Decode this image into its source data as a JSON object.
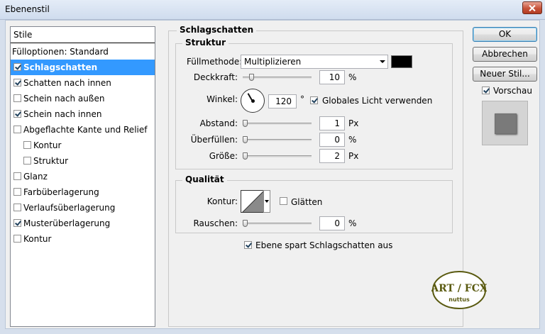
{
  "window": {
    "title": "Ebenenstil"
  },
  "styles": {
    "header": "Stile",
    "items": [
      {
        "label": "Fülloptionen: Standard",
        "has_checkbox": false,
        "checked": false,
        "selected": false,
        "indent": 0
      },
      {
        "label": "Schlagschatten",
        "has_checkbox": true,
        "checked": true,
        "selected": true,
        "indent": 0
      },
      {
        "label": "Schatten nach innen",
        "has_checkbox": true,
        "checked": true,
        "selected": false,
        "indent": 0
      },
      {
        "label": "Schein nach außen",
        "has_checkbox": true,
        "checked": false,
        "selected": false,
        "indent": 0
      },
      {
        "label": "Schein nach innen",
        "has_checkbox": true,
        "checked": true,
        "selected": false,
        "indent": 0
      },
      {
        "label": "Abgeflachte Kante und Relief",
        "has_checkbox": true,
        "checked": false,
        "selected": false,
        "indent": 0
      },
      {
        "label": "Kontur",
        "has_checkbox": true,
        "checked": false,
        "selected": false,
        "indent": 1
      },
      {
        "label": "Struktur",
        "has_checkbox": true,
        "checked": false,
        "selected": false,
        "indent": 1
      },
      {
        "label": "Glanz",
        "has_checkbox": true,
        "checked": false,
        "selected": false,
        "indent": 0
      },
      {
        "label": "Farbüberlagerung",
        "has_checkbox": true,
        "checked": false,
        "selected": false,
        "indent": 0
      },
      {
        "label": "Verlaufsüberlagerung",
        "has_checkbox": true,
        "checked": false,
        "selected": false,
        "indent": 0
      },
      {
        "label": "Musterüberlagerung",
        "has_checkbox": true,
        "checked": true,
        "selected": false,
        "indent": 0
      },
      {
        "label": "Kontur",
        "has_checkbox": true,
        "checked": false,
        "selected": false,
        "indent": 0
      }
    ]
  },
  "section": {
    "title": "Schlagschatten",
    "structure": {
      "title": "Struktur",
      "blend_mode_label": "Füllmethode:",
      "blend_mode_value": "Multiplizieren",
      "shadow_color": "#000000",
      "opacity_label": "Deckkraft:",
      "opacity_value": "10",
      "opacity_unit": "%",
      "opacity_level": 0.1,
      "angle_label": "Winkel:",
      "angle_value": "120",
      "angle_unit": "°",
      "global_light_label": "Globales Licht verwenden",
      "global_light_checked": true,
      "distance_label": "Abstand:",
      "distance_value": "1",
      "distance_unit": "Px",
      "spread_label": "Überfüllen:",
      "spread_value": "0",
      "spread_unit": "%",
      "size_label": "Größe:",
      "size_value": "2",
      "size_unit": "Px"
    },
    "quality": {
      "title": "Qualität",
      "contour_label": "Kontur:",
      "antialias_label": "Glätten",
      "antialias_checked": false,
      "noise_label": "Rauschen:",
      "noise_value": "0",
      "noise_unit": "%"
    },
    "knockout_label": "Ebene spart Schlagschatten aus",
    "knockout_checked": true
  },
  "buttons": {
    "ok": "OK",
    "cancel": "Abbrechen",
    "new_style": "Neuer Stil...",
    "preview_label": "Vorschau",
    "preview_checked": true
  },
  "logo": {
    "text_top": "ART / FCX",
    "text_bottom": "nuttus",
    "color": "#5a5a10"
  }
}
